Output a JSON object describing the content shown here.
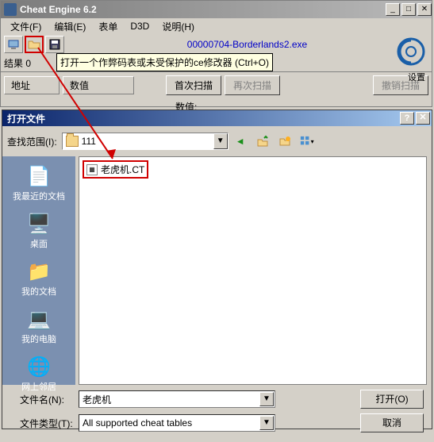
{
  "app": {
    "title": "Cheat Engine 6.2",
    "menus": [
      "文件(F)",
      "编辑(E)",
      "表单",
      "D3D",
      "说明(H)"
    ],
    "process": "00000704-Borderlands2.exe",
    "tooltip": "打开一个作弊码表或未受保护的ce修改器 (Ctrl+O)",
    "result_label": "结果",
    "result_count": "0",
    "col_address": "地址",
    "col_value": "数值",
    "btn_first_scan": "首次扫描",
    "btn_next_scan": "再次扫描",
    "btn_undo_scan": "撤销扫描",
    "value_label": "数值:",
    "settings_label": "设置"
  },
  "dialog": {
    "title": "打开文件",
    "lookin_label": "查找范围(I):",
    "folder": "111",
    "sidebar": {
      "recent": "我最近的文档",
      "desktop": "桌面",
      "mydocs": "我的文档",
      "mycomp": "我的电脑",
      "network": "网上邻居"
    },
    "file_item": "老虎机.CT",
    "filename_label": "文件名(N):",
    "filename_value": "老虎机",
    "filetype_label": "文件类型(T):",
    "filetype_value": "All supported cheat tables",
    "btn_open": "打开(O)",
    "btn_cancel": "取消"
  }
}
